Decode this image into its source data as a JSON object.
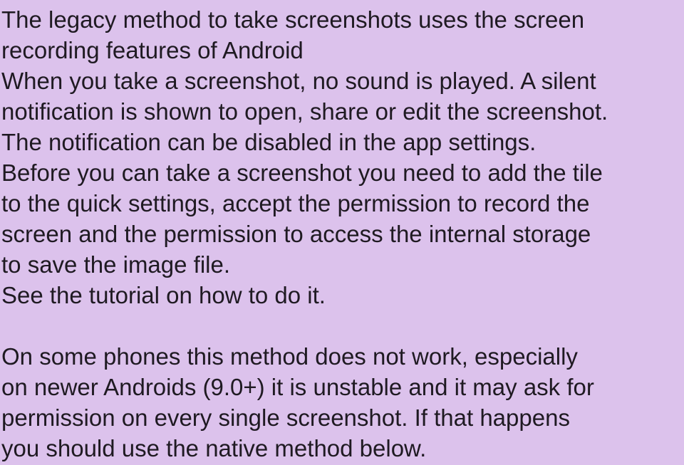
{
  "paragraph_1": {
    "lines": [
      "The legacy method to take screenshots uses the screen",
      "recording features of Android",
      "When you take a screenshot, no sound is played. A silent",
      "notification is shown to open, share or edit the screenshot.",
      "The notification can be disabled in the app settings.",
      "Before you can take a screenshot you need to add the tile",
      "to the quick settings, accept the permission to record the",
      "screen and the permission to access the internal storage",
      "to save the image file.",
      "See the tutorial on how to do it."
    ]
  },
  "paragraph_2": {
    "lines": [
      "On some phones this method does not work, especially",
      "on newer Androids (9.0+) it is unstable and it may ask for",
      "permission on every single screenshot. If that happens",
      "you should use the native method below."
    ]
  }
}
